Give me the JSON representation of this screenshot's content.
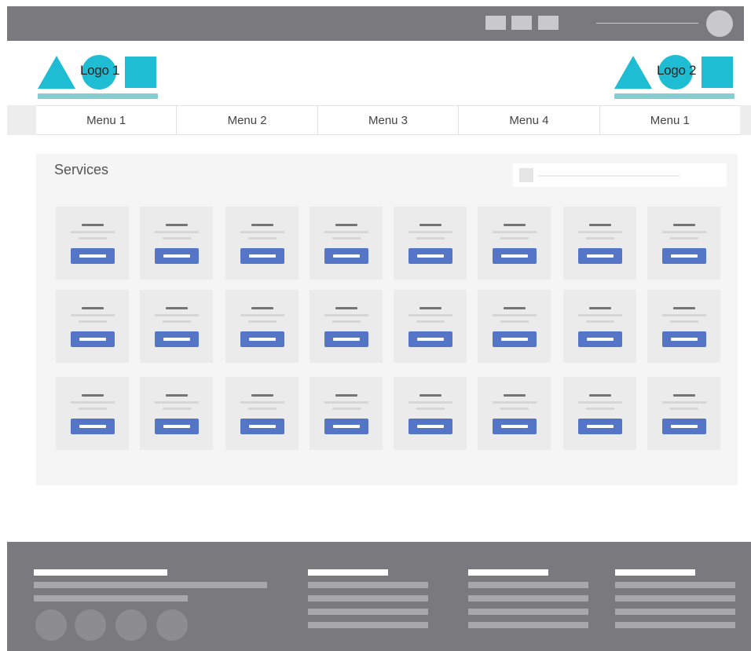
{
  "logos": {
    "left_label": "Logo 1",
    "right_label": "Logo 2"
  },
  "nav": {
    "items": [
      "Menu 1",
      "Menu 2",
      "Menu 3",
      "Menu 4",
      "Menu 1"
    ]
  },
  "services": {
    "title": "Services"
  }
}
